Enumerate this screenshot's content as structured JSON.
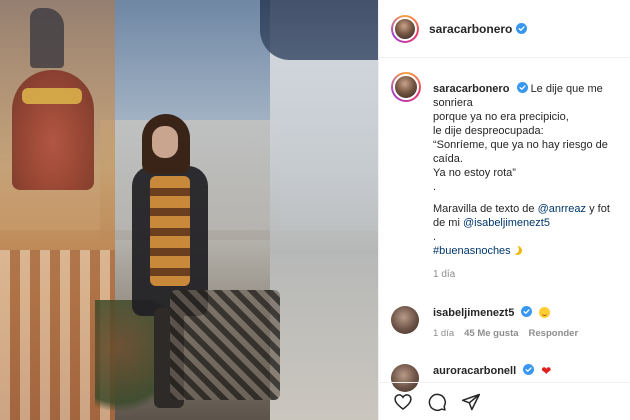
{
  "post": {
    "username": "saracarbonero",
    "verified": true
  },
  "caption": {
    "username": "saracarbonero",
    "lines": [
      "Le dije que me",
      "sonriera",
      "porque ya no era precipicio,",
      "le dije despreocupada:",
      "“Sonríeme, que ya no hay riesgo de",
      "caída.",
      "Ya no estoy rota”",
      ".",
      "",
      "Maravilla de texto de @anrreaz y fot",
      "de mi @isabeljimenezt5",
      ".",
      "#buenasnoches"
    ],
    "mention1": "@anrreaz",
    "mention2": "@isabeljimenezt5",
    "hashtag": "#buenasnoches",
    "time": "1 día"
  },
  "comments": [
    {
      "username": "isabeljimenezt5",
      "verified": true,
      "emoji": "relieved-face",
      "time": "1 día",
      "likes": "45 Me gusta",
      "reply": "Responder"
    },
    {
      "username": "auroracarbonell",
      "verified": true,
      "emoji": "red-heart"
    }
  ],
  "actions": [
    "heart-icon",
    "comment-icon",
    "share-icon"
  ],
  "colors": {
    "verified": "#3897f0",
    "link": "#00376b",
    "muted": "#8e8e8e"
  }
}
